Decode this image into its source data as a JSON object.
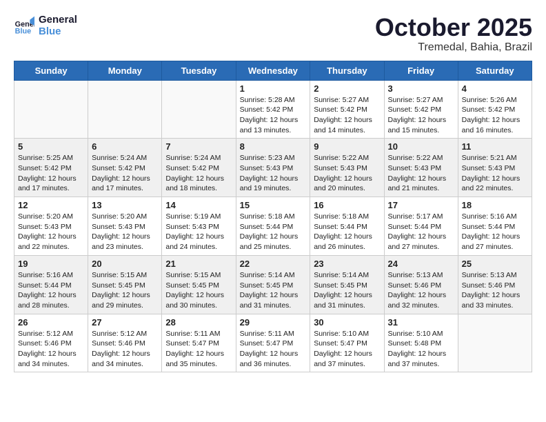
{
  "header": {
    "logo_line1": "General",
    "logo_line2": "Blue",
    "month": "October 2025",
    "location": "Tremedal, Bahia, Brazil"
  },
  "weekdays": [
    "Sunday",
    "Monday",
    "Tuesday",
    "Wednesday",
    "Thursday",
    "Friday",
    "Saturday"
  ],
  "weeks": [
    [
      {
        "day": "",
        "info": ""
      },
      {
        "day": "",
        "info": ""
      },
      {
        "day": "",
        "info": ""
      },
      {
        "day": "1",
        "info": "Sunrise: 5:28 AM\nSunset: 5:42 PM\nDaylight: 12 hours\nand 13 minutes."
      },
      {
        "day": "2",
        "info": "Sunrise: 5:27 AM\nSunset: 5:42 PM\nDaylight: 12 hours\nand 14 minutes."
      },
      {
        "day": "3",
        "info": "Sunrise: 5:27 AM\nSunset: 5:42 PM\nDaylight: 12 hours\nand 15 minutes."
      },
      {
        "day": "4",
        "info": "Sunrise: 5:26 AM\nSunset: 5:42 PM\nDaylight: 12 hours\nand 16 minutes."
      }
    ],
    [
      {
        "day": "5",
        "info": "Sunrise: 5:25 AM\nSunset: 5:42 PM\nDaylight: 12 hours\nand 17 minutes."
      },
      {
        "day": "6",
        "info": "Sunrise: 5:24 AM\nSunset: 5:42 PM\nDaylight: 12 hours\nand 17 minutes."
      },
      {
        "day": "7",
        "info": "Sunrise: 5:24 AM\nSunset: 5:42 PM\nDaylight: 12 hours\nand 18 minutes."
      },
      {
        "day": "8",
        "info": "Sunrise: 5:23 AM\nSunset: 5:43 PM\nDaylight: 12 hours\nand 19 minutes."
      },
      {
        "day": "9",
        "info": "Sunrise: 5:22 AM\nSunset: 5:43 PM\nDaylight: 12 hours\nand 20 minutes."
      },
      {
        "day": "10",
        "info": "Sunrise: 5:22 AM\nSunset: 5:43 PM\nDaylight: 12 hours\nand 21 minutes."
      },
      {
        "day": "11",
        "info": "Sunrise: 5:21 AM\nSunset: 5:43 PM\nDaylight: 12 hours\nand 22 minutes."
      }
    ],
    [
      {
        "day": "12",
        "info": "Sunrise: 5:20 AM\nSunset: 5:43 PM\nDaylight: 12 hours\nand 22 minutes."
      },
      {
        "day": "13",
        "info": "Sunrise: 5:20 AM\nSunset: 5:43 PM\nDaylight: 12 hours\nand 23 minutes."
      },
      {
        "day": "14",
        "info": "Sunrise: 5:19 AM\nSunset: 5:43 PM\nDaylight: 12 hours\nand 24 minutes."
      },
      {
        "day": "15",
        "info": "Sunrise: 5:18 AM\nSunset: 5:44 PM\nDaylight: 12 hours\nand 25 minutes."
      },
      {
        "day": "16",
        "info": "Sunrise: 5:18 AM\nSunset: 5:44 PM\nDaylight: 12 hours\nand 26 minutes."
      },
      {
        "day": "17",
        "info": "Sunrise: 5:17 AM\nSunset: 5:44 PM\nDaylight: 12 hours\nand 27 minutes."
      },
      {
        "day": "18",
        "info": "Sunrise: 5:16 AM\nSunset: 5:44 PM\nDaylight: 12 hours\nand 27 minutes."
      }
    ],
    [
      {
        "day": "19",
        "info": "Sunrise: 5:16 AM\nSunset: 5:44 PM\nDaylight: 12 hours\nand 28 minutes."
      },
      {
        "day": "20",
        "info": "Sunrise: 5:15 AM\nSunset: 5:45 PM\nDaylight: 12 hours\nand 29 minutes."
      },
      {
        "day": "21",
        "info": "Sunrise: 5:15 AM\nSunset: 5:45 PM\nDaylight: 12 hours\nand 30 minutes."
      },
      {
        "day": "22",
        "info": "Sunrise: 5:14 AM\nSunset: 5:45 PM\nDaylight: 12 hours\nand 31 minutes."
      },
      {
        "day": "23",
        "info": "Sunrise: 5:14 AM\nSunset: 5:45 PM\nDaylight: 12 hours\nand 31 minutes."
      },
      {
        "day": "24",
        "info": "Sunrise: 5:13 AM\nSunset: 5:46 PM\nDaylight: 12 hours\nand 32 minutes."
      },
      {
        "day": "25",
        "info": "Sunrise: 5:13 AM\nSunset: 5:46 PM\nDaylight: 12 hours\nand 33 minutes."
      }
    ],
    [
      {
        "day": "26",
        "info": "Sunrise: 5:12 AM\nSunset: 5:46 PM\nDaylight: 12 hours\nand 34 minutes."
      },
      {
        "day": "27",
        "info": "Sunrise: 5:12 AM\nSunset: 5:46 PM\nDaylight: 12 hours\nand 34 minutes."
      },
      {
        "day": "28",
        "info": "Sunrise: 5:11 AM\nSunset: 5:47 PM\nDaylight: 12 hours\nand 35 minutes."
      },
      {
        "day": "29",
        "info": "Sunrise: 5:11 AM\nSunset: 5:47 PM\nDaylight: 12 hours\nand 36 minutes."
      },
      {
        "day": "30",
        "info": "Sunrise: 5:10 AM\nSunset: 5:47 PM\nDaylight: 12 hours\nand 37 minutes."
      },
      {
        "day": "31",
        "info": "Sunrise: 5:10 AM\nSunset: 5:48 PM\nDaylight: 12 hours\nand 37 minutes."
      },
      {
        "day": "",
        "info": ""
      }
    ]
  ]
}
